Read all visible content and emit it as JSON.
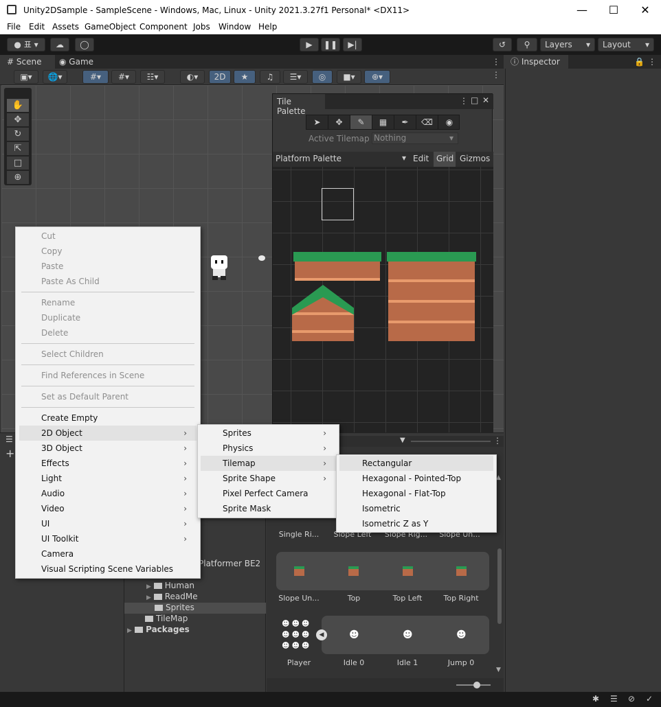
{
  "window": {
    "title": "Unity2DSample - SampleScene - Windows, Mac, Linux - Unity 2021.3.27f1 Personal* <DX11>"
  },
  "menubar": [
    "File",
    "Edit",
    "Assets",
    "GameObject",
    "Component",
    "Jobs",
    "Window",
    "Help"
  ],
  "toolbar": {
    "account": "표",
    "layers": "Layers",
    "layout": "Layout"
  },
  "tabs": {
    "scene": "Scene",
    "game": "Game",
    "inspector": "Inspector"
  },
  "scene_toolbar": {
    "mode_2d": "2D"
  },
  "tile_palette": {
    "title": "Tile Palette",
    "active_tilemap_label": "Active Tilemap",
    "active_tilemap_value": "Nothing",
    "palette_name": "Platform Palette",
    "edit": "Edit",
    "grid": "Grid",
    "gizmos": "Gizmos"
  },
  "context_menu": {
    "items": [
      {
        "label": "Cut",
        "disabled": true
      },
      {
        "label": "Copy",
        "disabled": true
      },
      {
        "label": "Paste",
        "disabled": true
      },
      {
        "label": "Paste As Child",
        "disabled": true
      },
      {
        "label": "Rename",
        "disabled": true
      },
      {
        "label": "Duplicate",
        "disabled": true
      },
      {
        "label": "Delete",
        "disabled": true
      },
      {
        "label": "Select Children",
        "disabled": true
      },
      {
        "label": "Find References in Scene",
        "disabled": true
      },
      {
        "label": "Set as Default Parent",
        "disabled": true
      },
      {
        "label": "Create Empty"
      },
      {
        "label": "2D Object"
      },
      {
        "label": "3D Object"
      },
      {
        "label": "Effects"
      },
      {
        "label": "Light"
      },
      {
        "label": "Audio"
      },
      {
        "label": "Video"
      },
      {
        "label": "UI"
      },
      {
        "label": "UI Toolkit"
      },
      {
        "label": "Camera"
      },
      {
        "label": "Visual Scripting Scene Variables"
      }
    ]
  },
  "submenu_2d": [
    "Sprites",
    "Physics",
    "Tilemap",
    "Sprite Shape",
    "Pixel Perfect Camera",
    "Sprite Mask"
  ],
  "submenu_tilemap": [
    "Rectangular",
    "Hexagonal - Pointed-Top",
    "Hexagonal - Flat-Top",
    "Isometric",
    "Isometric Z as Y"
  ],
  "project": {
    "partial_folder": "Platformer BE2",
    "folders": [
      "Human",
      "ReadMe",
      "Sprites",
      "TileMap",
      "Packages"
    ],
    "row1_labels": [
      "Single Ri...",
      "Slope Left",
      "Slope Rig...",
      "Slope Un..."
    ],
    "row2_labels": [
      "Slope Un...",
      "Top",
      "Top Left",
      "Top Right"
    ],
    "row3_labels": [
      "Player",
      "Idle 0",
      "Idle 1",
      "Jump 0"
    ]
  },
  "colors": {
    "grass": "#2a9a52",
    "dirt": "#b86a48",
    "dirt_wave": "#e89a6c"
  }
}
